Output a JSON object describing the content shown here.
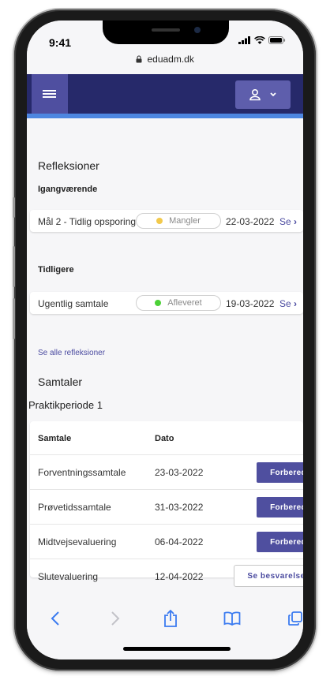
{
  "status_bar": {
    "time": "9:41"
  },
  "browser": {
    "url": "eduadm.dk"
  },
  "reflections": {
    "heading": "Refleksioner",
    "ongoing_heading": "Igangværende",
    "ongoing": [
      {
        "name": "Mål 2 - Tidlig opsporing",
        "status": "Mangler",
        "status_color": "#f2c94c",
        "date": "22-03-2022",
        "action": "Se"
      }
    ],
    "previous_heading": "Tidligere",
    "previous": [
      {
        "name": "Ugentlig samtale",
        "status": "Afleveret",
        "status_color": "#4cd137",
        "date": "19-03-2022",
        "action": "Se"
      }
    ],
    "see_all": "Se alle refleksioner"
  },
  "conversations": {
    "heading": "Samtaler",
    "period": "Praktikperiode 1",
    "columns": {
      "name": "Samtale",
      "date": "Dato"
    },
    "rows": [
      {
        "name": "Forventningssamtale",
        "date": "23-03-2022",
        "button": "Forbered"
      },
      {
        "name": "Prøvetidssamtale",
        "date": "31-03-2022",
        "button": "Forbered"
      },
      {
        "name": "Midtvejsevaluering",
        "date": "06-04-2022",
        "button": "Forbered"
      },
      {
        "name": "Slutevaluering",
        "date": "12-04-2022",
        "button": "Se besvarelse"
      }
    ]
  },
  "icons": {
    "signal": "signal-icon",
    "wifi": "wifi-icon",
    "battery": "battery-icon",
    "lock": "lock-icon",
    "menu": "hamburger-menu-icon",
    "user": "user-icon",
    "dropdown": "chevron-down-icon",
    "back": "chevron-left-icon",
    "forward": "chevron-right-icon",
    "share": "share-icon",
    "bookmarks": "book-icon",
    "tabs": "tabs-icon"
  },
  "colors": {
    "header_bg": "#26296a",
    "header_accent": "#4d86e0",
    "primary": "#4f4f9f",
    "link": "#4b4ba0"
  }
}
